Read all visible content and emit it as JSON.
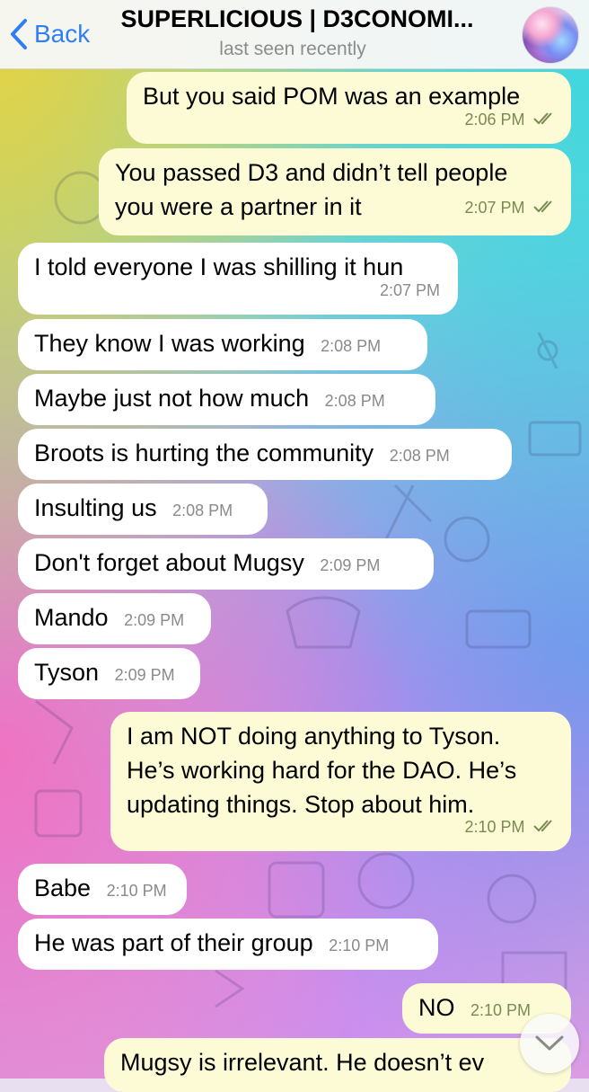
{
  "header": {
    "back_label": "Back",
    "title": "SUPERLICIOUS | D3CONOMI...",
    "status": "last seen recently"
  },
  "messages": [
    {
      "side": "out",
      "text": "But you said POM was an example",
      "time": "2:06 PM",
      "read": true
    },
    {
      "side": "out",
      "lines": [
        "You passed D3 and didn’t tell people",
        "you were a partner in it"
      ],
      "time": "2:07 PM",
      "read": true
    },
    {
      "side": "in",
      "text": "I told everyone I was shilling it hun",
      "time": "2:07 PM"
    },
    {
      "side": "in",
      "text": "They know I was working",
      "time": "2:08 PM"
    },
    {
      "side": "in",
      "text": "Maybe just not how much",
      "time": "2:08 PM"
    },
    {
      "side": "in",
      "text": "Broots is hurting the community",
      "time": "2:08 PM"
    },
    {
      "side": "in",
      "text": "Insulting us",
      "time": "2:08 PM"
    },
    {
      "side": "in",
      "text": "Don't forget about Mugsy",
      "time": "2:09 PM"
    },
    {
      "side": "in",
      "text": "Mando",
      "time": "2:09 PM"
    },
    {
      "side": "in",
      "text": "Tyson",
      "time": "2:09 PM"
    },
    {
      "side": "out",
      "lines": [
        "I am NOT doing anything to Tyson.",
        "He’s working hard for the DAO. He’s",
        "updating things. Stop about him."
      ],
      "time": "2:10 PM",
      "read": true
    },
    {
      "side": "in",
      "text": "Babe",
      "time": "2:10 PM"
    },
    {
      "side": "in",
      "text": "He was part of their group",
      "time": "2:10 PM"
    },
    {
      "side": "out",
      "text": "NO",
      "time": "2:10 PM",
      "read": true
    },
    {
      "side": "out",
      "text": "Mugsy is irrelevant. He doesn’t ev"
    }
  ],
  "icons": {
    "back": "chevron-left-icon",
    "read_receipt": "double-check-icon",
    "scroll_down": "chevron-down-icon"
  },
  "colors": {
    "accent": "#2f7ef6",
    "incoming_bubble": "#ffffff",
    "outgoing_bubble": "#fdfbd6"
  }
}
